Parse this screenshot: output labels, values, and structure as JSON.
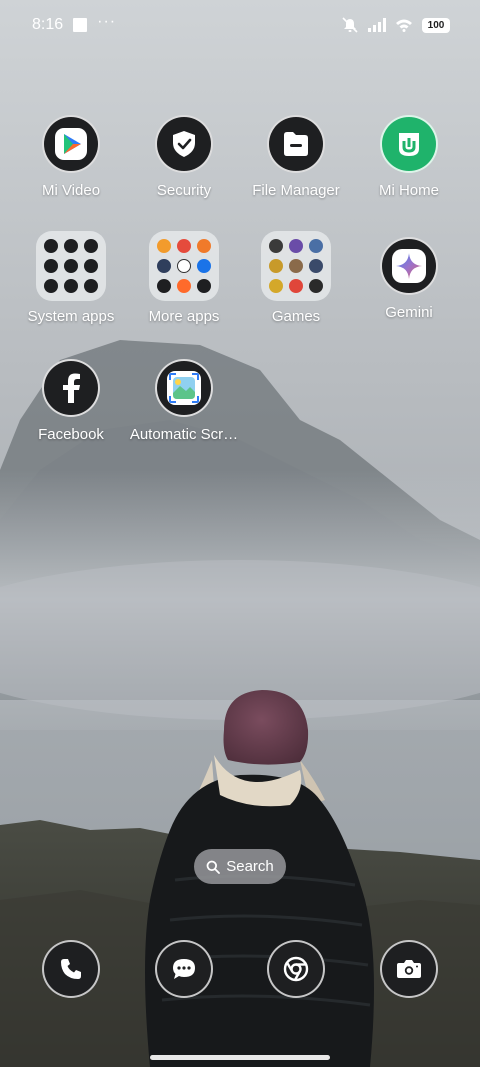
{
  "status_bar": {
    "time": "8:16",
    "battery": "100"
  },
  "apps": [
    {
      "label": "Mi Video",
      "icon": "mi-video-icon"
    },
    {
      "label": "Security",
      "icon": "security-shield-icon"
    },
    {
      "label": "File Manager",
      "icon": "file-manager-icon"
    },
    {
      "label": "Mi Home",
      "icon": "mi-home-icon"
    },
    {
      "label": "System apps",
      "icon": "folder-icon"
    },
    {
      "label": "More apps",
      "icon": "folder-icon"
    },
    {
      "label": "Games",
      "icon": "folder-icon"
    },
    {
      "label": "Gemini",
      "icon": "gemini-icon"
    },
    {
      "label": "Facebook",
      "icon": "facebook-icon"
    },
    {
      "label": "Automatic Scr…",
      "icon": "screenshot-app-icon"
    }
  ],
  "search": {
    "label": "Search"
  },
  "dock": [
    {
      "icon": "phone-icon"
    },
    {
      "icon": "messages-icon"
    },
    {
      "icon": "chrome-icon"
    },
    {
      "icon": "camera-icon"
    }
  ],
  "colors": {
    "icon_bg": "#1e1f21",
    "mi_home_green": "#1fb36b",
    "sky": "#c9cdd1"
  }
}
